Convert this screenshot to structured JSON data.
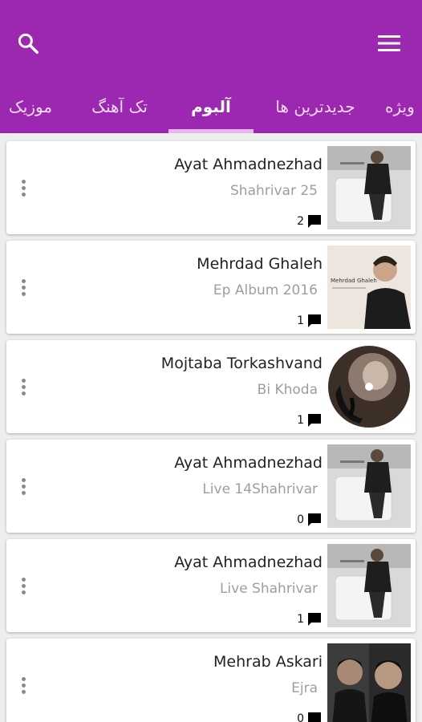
{
  "colors": {
    "primary": "#9c27b0",
    "tab_indicator": "#e5b9ec",
    "background": "#eeeeee"
  },
  "toolbar": {
    "search_icon": "search-icon",
    "menu_icon": "hamburger-menu-icon"
  },
  "tabs": [
    {
      "label": "موزیک"
    },
    {
      "label": "تک آهنگ"
    },
    {
      "label": "آلبوم",
      "active": true
    },
    {
      "label": "جدیدترین ها"
    },
    {
      "label": "ویژه"
    }
  ],
  "albums": [
    {
      "artist": "Ayat Ahmadnezhad",
      "title": "Shahrivar 25",
      "comments": "2"
    },
    {
      "artist": "Mehrdad Ghaleh",
      "title": "Ep Album 2016",
      "comments": "1",
      "cover_text": "Mehrdad Ghaleh"
    },
    {
      "artist": "Mojtaba Torkashvand",
      "title": "Bi Khoda",
      "comments": "1"
    },
    {
      "artist": "Ayat Ahmadnezhad",
      "title": "Live 14Shahrivar",
      "comments": "0"
    },
    {
      "artist": "Ayat Ahmadnezhad",
      "title": "Live Shahrivar",
      "comments": "1"
    },
    {
      "artist": "Mehrab Askari",
      "title": "Ejra",
      "comments": "0"
    }
  ]
}
